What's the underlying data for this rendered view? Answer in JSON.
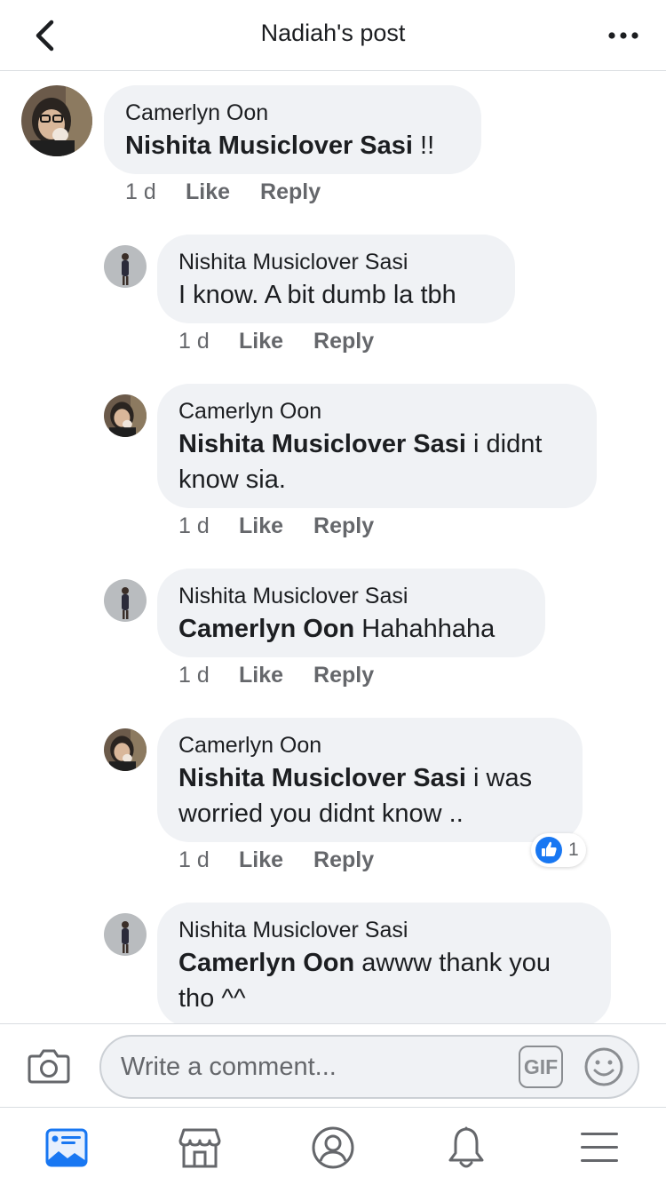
{
  "header": {
    "title": "Nadiah's post"
  },
  "comments": [
    {
      "author": "Camerlyn Oon",
      "mention": "Nishita Musiclover Sasi",
      "text": " !!",
      "time": "1 d",
      "like": "Like",
      "reply": "Reply",
      "avatar": "girl-avatar"
    },
    {
      "author": "Nishita Musiclover Sasi",
      "mention": "",
      "text": "I know. A bit dumb la tbh",
      "time": "1 d",
      "like": "Like",
      "reply": "Reply",
      "avatar": "standing-avatar"
    },
    {
      "author": "Camerlyn Oon",
      "mention": "Nishita Musiclover Sasi",
      "text": " i didnt know sia.",
      "time": "1 d",
      "like": "Like",
      "reply": "Reply",
      "avatar": "girl-avatar"
    },
    {
      "author": "Nishita Musiclover Sasi",
      "mention": "Camerlyn Oon",
      "text": " Hahahhaha",
      "time": "1 d",
      "like": "Like",
      "reply": "Reply",
      "avatar": "standing-avatar"
    },
    {
      "author": "Camerlyn Oon",
      "mention": "Nishita Musiclover Sasi",
      "text": " i was worried you didnt know ..",
      "time": "1 d",
      "like": "Like",
      "reply": "Reply",
      "avatar": "girl-avatar",
      "reaction_count": "1"
    },
    {
      "author": "Nishita Musiclover Sasi",
      "mention": "Camerlyn Oon",
      "text": " awww thank you tho ^^",
      "avatar": "standing-avatar"
    }
  ],
  "composer": {
    "placeholder": "Write a comment...",
    "gif_label": "GIF"
  },
  "colors": {
    "bubble": "#f0f2f5",
    "meta": "#65676b",
    "like_blue": "#1877f2",
    "active_tab": "#1877f2"
  },
  "tabs": [
    "news-feed-icon",
    "marketplace-icon",
    "profile-icon",
    "notifications-icon",
    "menu-icon"
  ]
}
